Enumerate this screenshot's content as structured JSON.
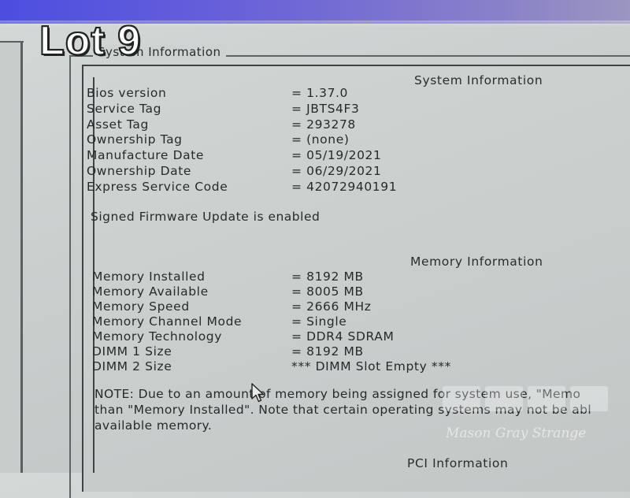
{
  "overlay": {
    "lot_label": "Lot 9"
  },
  "group": {
    "title": "System Information"
  },
  "system_information": {
    "heading": "System Information",
    "rows": [
      {
        "label": "Bios version",
        "value": "= 1.37.0"
      },
      {
        "label": "Service Tag",
        "value": "= JBTS4F3"
      },
      {
        "label": "Asset Tag",
        "value": "= 293278"
      },
      {
        "label": "Ownership Tag",
        "value": "= (none)"
      },
      {
        "label": "Manufacture Date",
        "value": "= 05/19/2021"
      },
      {
        "label": "Ownership Date",
        "value": "= 06/29/2021"
      },
      {
        "label": "Express Service Code",
        "value": "= 42072940191"
      }
    ],
    "firmware_status": "Signed Firmware Update is enabled"
  },
  "memory_information": {
    "heading": "Memory Information",
    "rows": [
      {
        "label": "Memory Installed",
        "value": "= 8192 MB"
      },
      {
        "label": "Memory Available",
        "value": "= 8005 MB"
      },
      {
        "label": "Memory Speed",
        "value": "= 2666 MHz"
      },
      {
        "label": "Memory Channel Mode",
        "value": "= Single"
      },
      {
        "label": "Memory Technology",
        "value": "= DDR4 SDRAM"
      },
      {
        "label": "DIMM 1 Size",
        "value": "= 8192 MB"
      },
      {
        "label": "DIMM 2 Size",
        "value": "*** DIMM Slot Empty ***"
      }
    ],
    "note_lines": [
      "NOTE: Due to an amount of memory being assigned for system use, \"Memo",
      "than \"Memory Installed\". Note that certain operating systems may not be abl",
      "available memory."
    ]
  },
  "pci_information": {
    "heading": "PCI Information"
  },
  "watermark": {
    "text": "Mason Gray Strange"
  }
}
